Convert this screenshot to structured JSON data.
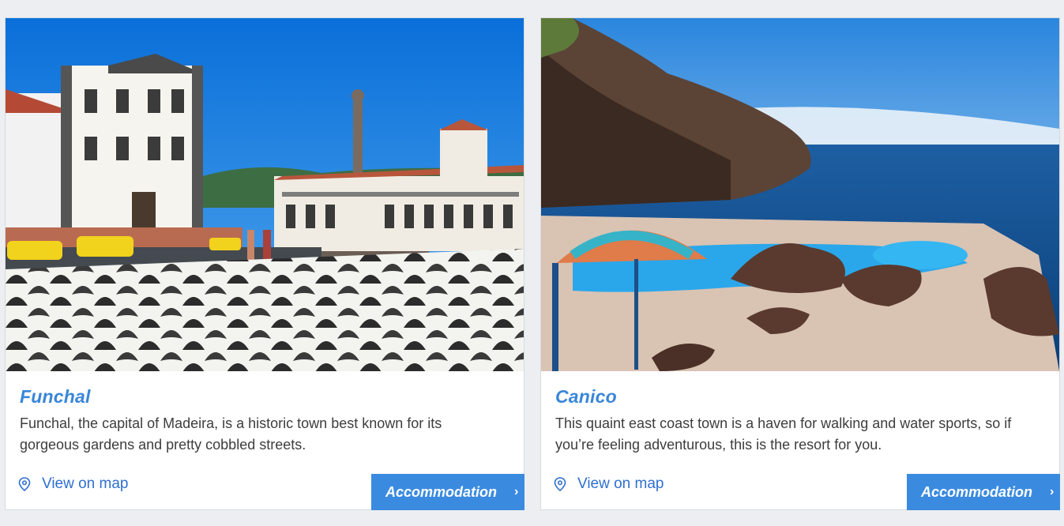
{
  "cards": [
    {
      "title": "Funchal",
      "description": "Funchal, the capital of Madeira, is a historic town best known for its gorgeous gardens and pretty cobbled streets.",
      "map_link": "View on map",
      "button_label": "Accommodation",
      "button_icon": "chevron-right-icon",
      "map_icon": "map-pin-icon"
    },
    {
      "title": "Canico",
      "description": "This quaint east coast town is a haven for walking and water sports, so if you’re feeling adventurous, this is the resort for you.",
      "map_link": "View on map",
      "button_label": "Accommodation",
      "button_icon": "chevron-right-icon",
      "map_icon": "map-pin-icon"
    }
  ],
  "colors": {
    "accent": "#3a8be0",
    "title": "#3a86d8",
    "link": "#2f6fcf",
    "text": "#3d3d3d",
    "page_bg": "#eceef1"
  }
}
